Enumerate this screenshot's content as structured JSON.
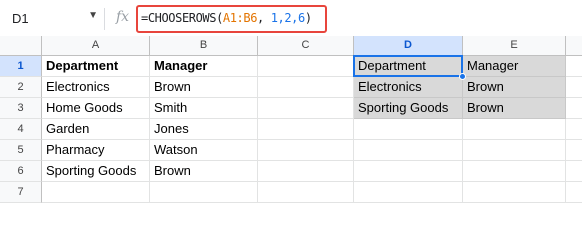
{
  "formula_bar": {
    "cell_ref": "D1",
    "formula": {
      "prefix": "=CHOOSEROWS(",
      "range": "A1:B6",
      "separator": ", ",
      "args": "1,2,6",
      "suffix": ")"
    },
    "fx_label": "fx"
  },
  "columns": [
    "A",
    "B",
    "C",
    "D",
    "E"
  ],
  "selected_column": "D",
  "selected_row": "1",
  "rows": [
    {
      "num": "1",
      "A": "Department",
      "B": "Manager",
      "C": "",
      "D": "Department",
      "E": "Manager"
    },
    {
      "num": "2",
      "A": "Electronics",
      "B": "Brown",
      "C": "",
      "D": "Electronics",
      "E": "Brown"
    },
    {
      "num": "3",
      "A": "Home Goods",
      "B": "Smith",
      "C": "",
      "D": "Sporting Goods",
      "E": "Brown"
    },
    {
      "num": "4",
      "A": "Garden",
      "B": "Jones",
      "C": "",
      "D": "",
      "E": ""
    },
    {
      "num": "5",
      "A": "Pharmacy",
      "B": "Watson",
      "C": "",
      "D": "",
      "E": ""
    },
    {
      "num": "6",
      "A": "Sporting Goods",
      "B": "Brown",
      "C": "",
      "D": "",
      "E": ""
    },
    {
      "num": "7",
      "A": "",
      "B": "",
      "C": "",
      "D": "",
      "E": ""
    }
  ],
  "colors": {
    "formula_highlight": "#e8453c",
    "selection": "#1a73e8",
    "spill_fill": "#d9d9d9",
    "range_ref": "#e37400",
    "number_arg": "#1a73e8"
  }
}
